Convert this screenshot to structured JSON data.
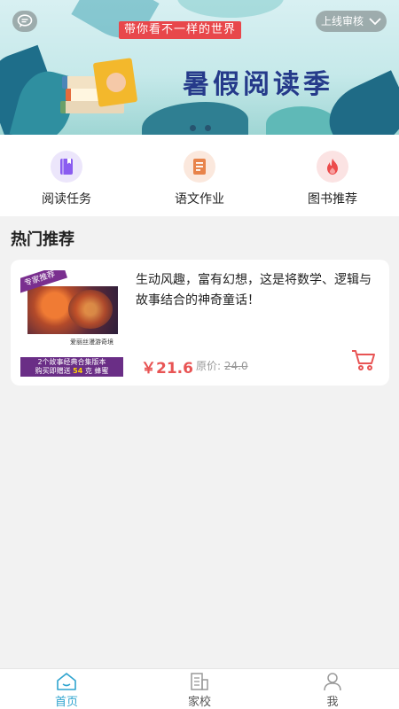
{
  "banner": {
    "slogan": "带你看不一样的世界",
    "title": "暑假阅读季",
    "review_label": "上线审核",
    "slide_count": 2
  },
  "menu": {
    "items": [
      {
        "label": "阅读任务",
        "icon": "book-icon",
        "color": "#8a5cf0",
        "bg": "#ece6fb"
      },
      {
        "label": "语文作业",
        "icon": "document-icon",
        "color": "#e8834a",
        "bg": "#fbe8dd"
      },
      {
        "label": "图书推荐",
        "icon": "flame-icon",
        "color": "#ec4b4b",
        "bg": "#fbe3e3"
      }
    ]
  },
  "section": {
    "title": "热门推荐"
  },
  "product": {
    "description": "生动风趣，富有幻想，这是将数学、逻辑与故事结合的神奇童话！",
    "price": "￥21.6",
    "original_label": "原价: ",
    "original_price": "24.0",
    "cover_badge": "专家推荐",
    "cover_title": "爱丽丝漫游奇境",
    "cover_band_line1": "2个故事经典合集版本",
    "cover_band_line2_pre": "购买即赠送 ",
    "cover_band_line2_hl": "54",
    "cover_band_line2_post": " 克 蜂蜜"
  },
  "nav": {
    "items": [
      {
        "label": "首页",
        "active": true
      },
      {
        "label": "家校",
        "active": false
      },
      {
        "label": "我",
        "active": false
      }
    ]
  },
  "colors": {
    "accent": "#2fa4cf",
    "price": "#e85454",
    "banner_title": "#253a8a"
  }
}
